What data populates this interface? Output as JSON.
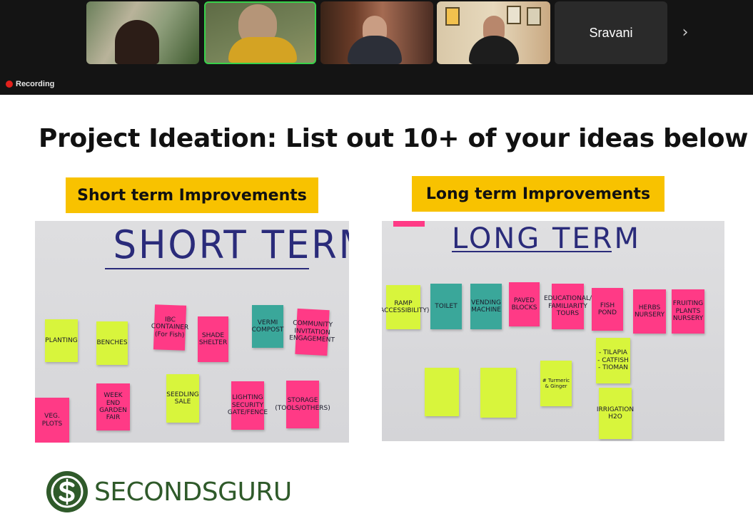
{
  "meeting": {
    "participants": [
      {
        "id": "p1",
        "name": ""
      },
      {
        "id": "p2",
        "name": ""
      },
      {
        "id": "p3",
        "name": ""
      },
      {
        "id": "p4",
        "name": ""
      },
      {
        "id": "p5",
        "name": "Sravani"
      }
    ],
    "recording_label": "Recording",
    "next_icon": "chevron-right-icon"
  },
  "slide": {
    "title": "Project Ideation: List out 10+ of your ideas below",
    "short_label": "Short term Improvements",
    "long_label": "Long term Improvements",
    "short_board": {
      "heading": "SHORT TERM",
      "notes": [
        {
          "text": "PLANTING",
          "color": "green"
        },
        {
          "text": "BENCHES",
          "color": "green"
        },
        {
          "text": "IBC CONTAINER (For Fish)",
          "color": "pink"
        },
        {
          "text": "SHADE SHELTER",
          "color": "pink"
        },
        {
          "text": "VERMI COMPOST",
          "color": "teal"
        },
        {
          "text": "COMMUNITY INVITATION ENGAGEMENT",
          "color": "pink"
        },
        {
          "text": "VEG. PLOTS",
          "color": "pink"
        },
        {
          "text": "WEEK END GARDEN FAIR",
          "color": "pink"
        },
        {
          "text": "SEEDLING SALE",
          "color": "green"
        },
        {
          "text": "LIGHTING SECURITY GATE/FENCE",
          "color": "pink"
        },
        {
          "text": "STORAGE (TOOLS/OTHERS)",
          "color": "pink"
        }
      ]
    },
    "long_board": {
      "heading": "LONG TERM",
      "notes": [
        {
          "text": "RAMP (ACCESSIBILITY)",
          "color": "green"
        },
        {
          "text": "TOILET",
          "color": "teal"
        },
        {
          "text": "VENDING MACHINE",
          "color": "teal"
        },
        {
          "text": "PAVED BLOCKS",
          "color": "pink"
        },
        {
          "text": "EDUCATIONAL/ FAMILIARITY TOURS",
          "color": "pink"
        },
        {
          "text": "FISH POND",
          "color": "pink"
        },
        {
          "text": "HERBS NURSERY",
          "color": "pink"
        },
        {
          "text": "FRUITING PLANTS NURSERY",
          "color": "pink"
        },
        {
          "text": "- TILAPIA - CATFISH - TIOMAN",
          "color": "green"
        },
        {
          "text": "IRRIGATION H2O",
          "color": "green"
        },
        {
          "text": "# Turmeric & Ginger",
          "color": "green"
        },
        {
          "text": "",
          "color": "green"
        },
        {
          "text": "",
          "color": "green"
        }
      ]
    }
  },
  "brand": {
    "logo_text": "SECONDSGURU",
    "logo_icon": "dollar-s-icon",
    "color": "#2f5a2a"
  },
  "colors": {
    "label_yellow": "#f8c200",
    "note_green": "#d8f53c",
    "note_pink": "#ff3a86",
    "note_teal": "#3aa79a",
    "marker_blue": "#2a2b7a",
    "active_speaker": "#37d24a"
  }
}
